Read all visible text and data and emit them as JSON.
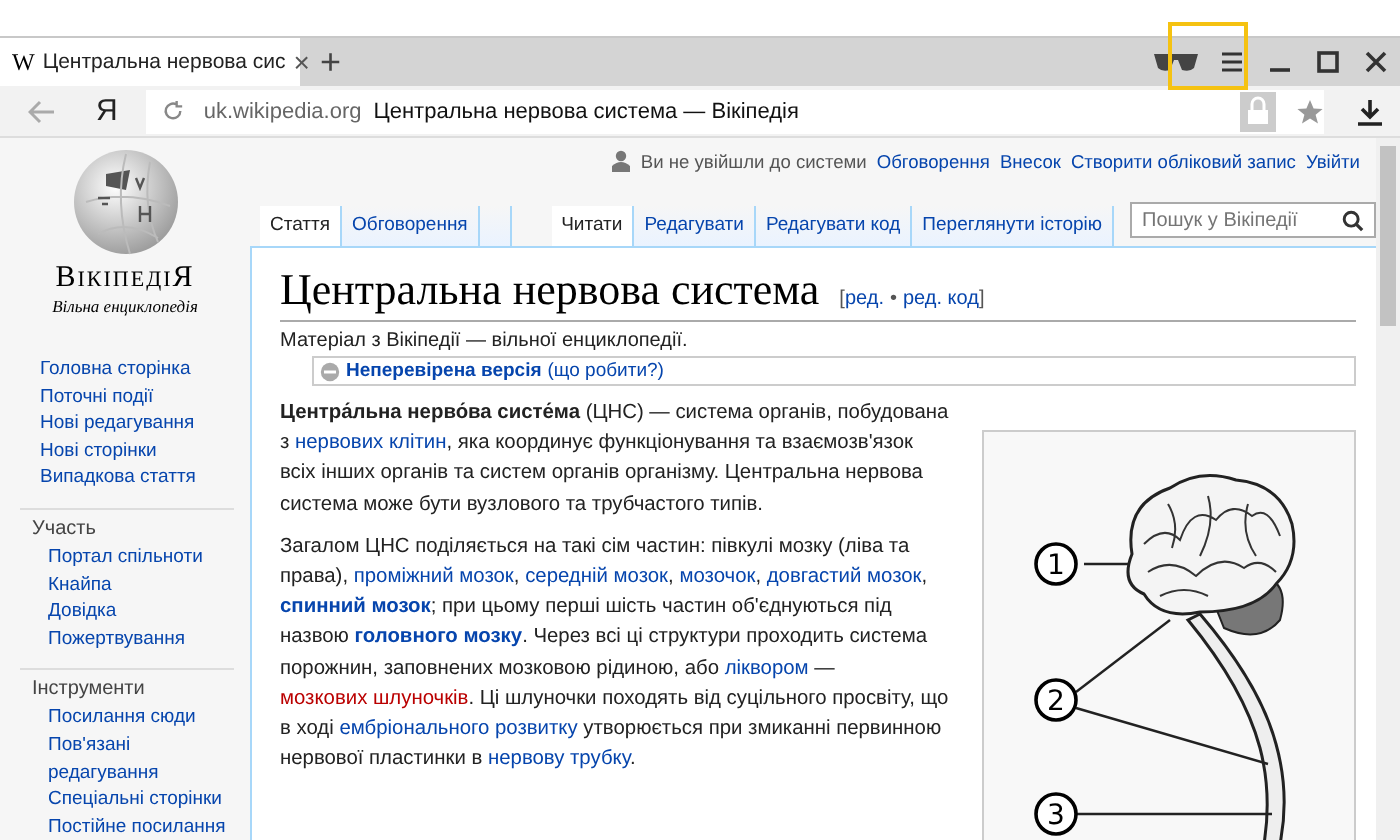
{
  "browser": {
    "favicon": "W",
    "tab_title": "Центральна нервова сис",
    "tab_close": "×",
    "new_tab": "+",
    "logo": "Я",
    "url_domain": "uk.wikipedia.org",
    "page_title": "Центральна нервова система — Вікіпедія"
  },
  "wiki": {
    "logo_title": "ВікіпедіЯ",
    "logo_tagline": "Вільна енциклопедія",
    "sidebar_main": [
      "Головна сторінка",
      "Поточні події",
      "Нові редагування",
      "Нові сторінки",
      "Випадкова стаття"
    ],
    "sidebar": [
      {
        "heading": "Участь",
        "items": [
          "Портал спільноти",
          "Кнайпа",
          "Довідка",
          "Пожертвування"
        ]
      },
      {
        "heading": "Інструменти",
        "items": [
          "Посилання сюди",
          "Пов'язані редагування",
          "Спеціальні сторінки",
          "Постійне посилання"
        ]
      }
    ],
    "personal": {
      "status": "Ви не увійшли до системи",
      "links": [
        "Обговорення",
        "Внесок",
        "Створити обліковий запис",
        "Увійти"
      ]
    },
    "tabs_left": [
      {
        "label": "Стаття",
        "selected": true
      },
      {
        "label": "Обговорення",
        "selected": false
      }
    ],
    "tabs_right": [
      {
        "label": "Читати",
        "selected": true
      },
      {
        "label": "Редагувати",
        "selected": false
      },
      {
        "label": "Редагувати код",
        "selected": false
      },
      {
        "label": "Переглянути історію",
        "selected": false
      }
    ],
    "search_placeholder": "Пошук у Вікіпедії",
    "heading": "Центральна нервова система",
    "edit_links": {
      "open": "[",
      "links": [
        "ред.",
        "ред. код"
      ],
      "separator": "•",
      "close": "]"
    },
    "tagline": "Матеріал з Вікіпедії — вільної енциклопедії.",
    "notice": {
      "label": "Неперевірена версія",
      "action": "(що робити?)"
    },
    "paragraphs": [
      {
        "segments": [
          {
            "text": "Центра́льна нерво́ва систе́ма",
            "kind": "bold"
          },
          {
            "text": " (ЦНС) — система органів, побудована з ",
            "kind": "plain"
          },
          {
            "text": "нервових клітин",
            "kind": "link"
          },
          {
            "text": ", яка координує функціонування та взаємозв'язок всіх інших органів та систем органів організму. Центральна нервова система може бути вузлового та трубчастого типів.",
            "kind": "plain"
          }
        ]
      },
      {
        "segments": [
          {
            "text": "Загалом ЦНС поділяється на такі сім частин: півкулі мозку (ліва та права), ",
            "kind": "plain"
          },
          {
            "text": "проміжний мозок",
            "kind": "link"
          },
          {
            "text": ", ",
            "kind": "plain"
          },
          {
            "text": "середній мозок",
            "kind": "link"
          },
          {
            "text": ", ",
            "kind": "plain"
          },
          {
            "text": "мозочок",
            "kind": "link"
          },
          {
            "text": ", ",
            "kind": "plain"
          },
          {
            "text": "довгастий мозок",
            "kind": "link"
          },
          {
            "text": ", ",
            "kind": "plain"
          },
          {
            "text": "спинний мозок",
            "kind": "link-bold"
          },
          {
            "text": "; при цьому перші шість частин об'єднуються під назвою ",
            "kind": "plain"
          },
          {
            "text": "головного мозку",
            "kind": "link-bold"
          },
          {
            "text": ". Через всі ці структури проходить система порожнин, заповнених мозковою рідиною, або ",
            "kind": "plain"
          },
          {
            "text": "ліквором",
            "kind": "link"
          },
          {
            "text": " — ",
            "kind": "plain"
          },
          {
            "text": "мозкових шлуночків",
            "kind": "redlink"
          },
          {
            "text": ". Ці шлуночки походять від суцільного просвіту, що в ході ",
            "kind": "plain"
          },
          {
            "text": "ембріонального розвитку",
            "kind": "link"
          },
          {
            "text": " утворюється при змиканні первинною нервової пластинки в ",
            "kind": "plain"
          },
          {
            "text": "нервову трубку",
            "kind": "link"
          },
          {
            "text": ".",
            "kind": "plain"
          }
        ]
      }
    ],
    "callouts": [
      "1",
      "2",
      "3"
    ]
  }
}
